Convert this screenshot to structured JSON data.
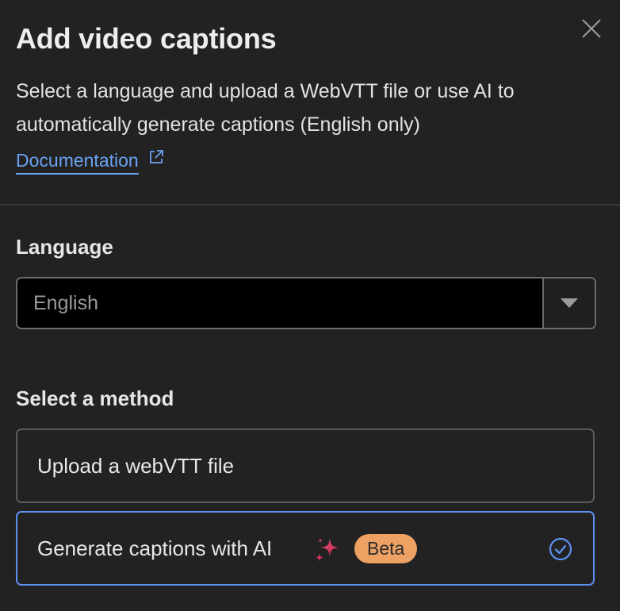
{
  "dialog": {
    "title": "Add video captions",
    "description": "Select a language and upload a WebVTT file or use AI to automatically generate captions (English only)",
    "documentation_link": "Documentation",
    "close_icon": "close-icon"
  },
  "language": {
    "label": "Language",
    "selected": "English",
    "dropdown_icon": "caret-down-icon"
  },
  "method": {
    "label": "Select a method",
    "options": [
      {
        "label": "Upload a webVTT file",
        "selected": false
      },
      {
        "label": "Generate captions with AI",
        "badge": "Beta",
        "icon": "sparkle-icon",
        "selected": true
      }
    ]
  },
  "colors": {
    "background": "#222222",
    "link": "#6aa2f2",
    "selected_border": "#5d8ff0",
    "beta_badge": "#eda264",
    "sparkle": "#d9355d"
  }
}
